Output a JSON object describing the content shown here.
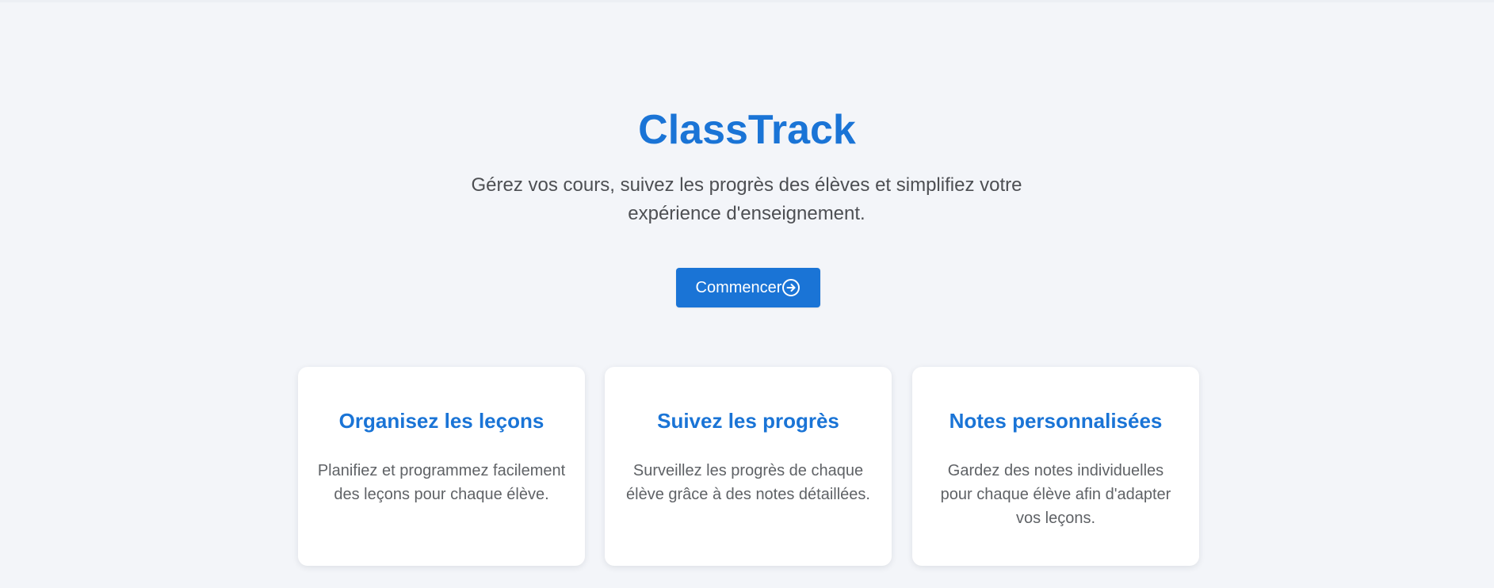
{
  "hero": {
    "title": "ClassTrack",
    "tagline": "Gérez vos cours, suivez les progrès des élèves et simplifiez votre expérience d'enseignement.",
    "cta_label": "Commencer",
    "cta_icon": "arrow-circle-right-icon"
  },
  "features": [
    {
      "title": "Organisez les leçons",
      "description": "Planifiez et programmez facilement des leçons pour chaque élève."
    },
    {
      "title": "Suivez les progrès",
      "description": "Surveillez les progrès de chaque élève grâce à des notes détaillées."
    },
    {
      "title": "Notes personnalisées",
      "description": "Gardez des notes individuelles pour chaque élève afin d'adapter vos leçons."
    }
  ],
  "colors": {
    "background": "#f3f5f9",
    "accent": "#1a74d6",
    "text": "#4d4f53",
    "card_text": "#5f6266",
    "card_background": "#ffffff"
  }
}
